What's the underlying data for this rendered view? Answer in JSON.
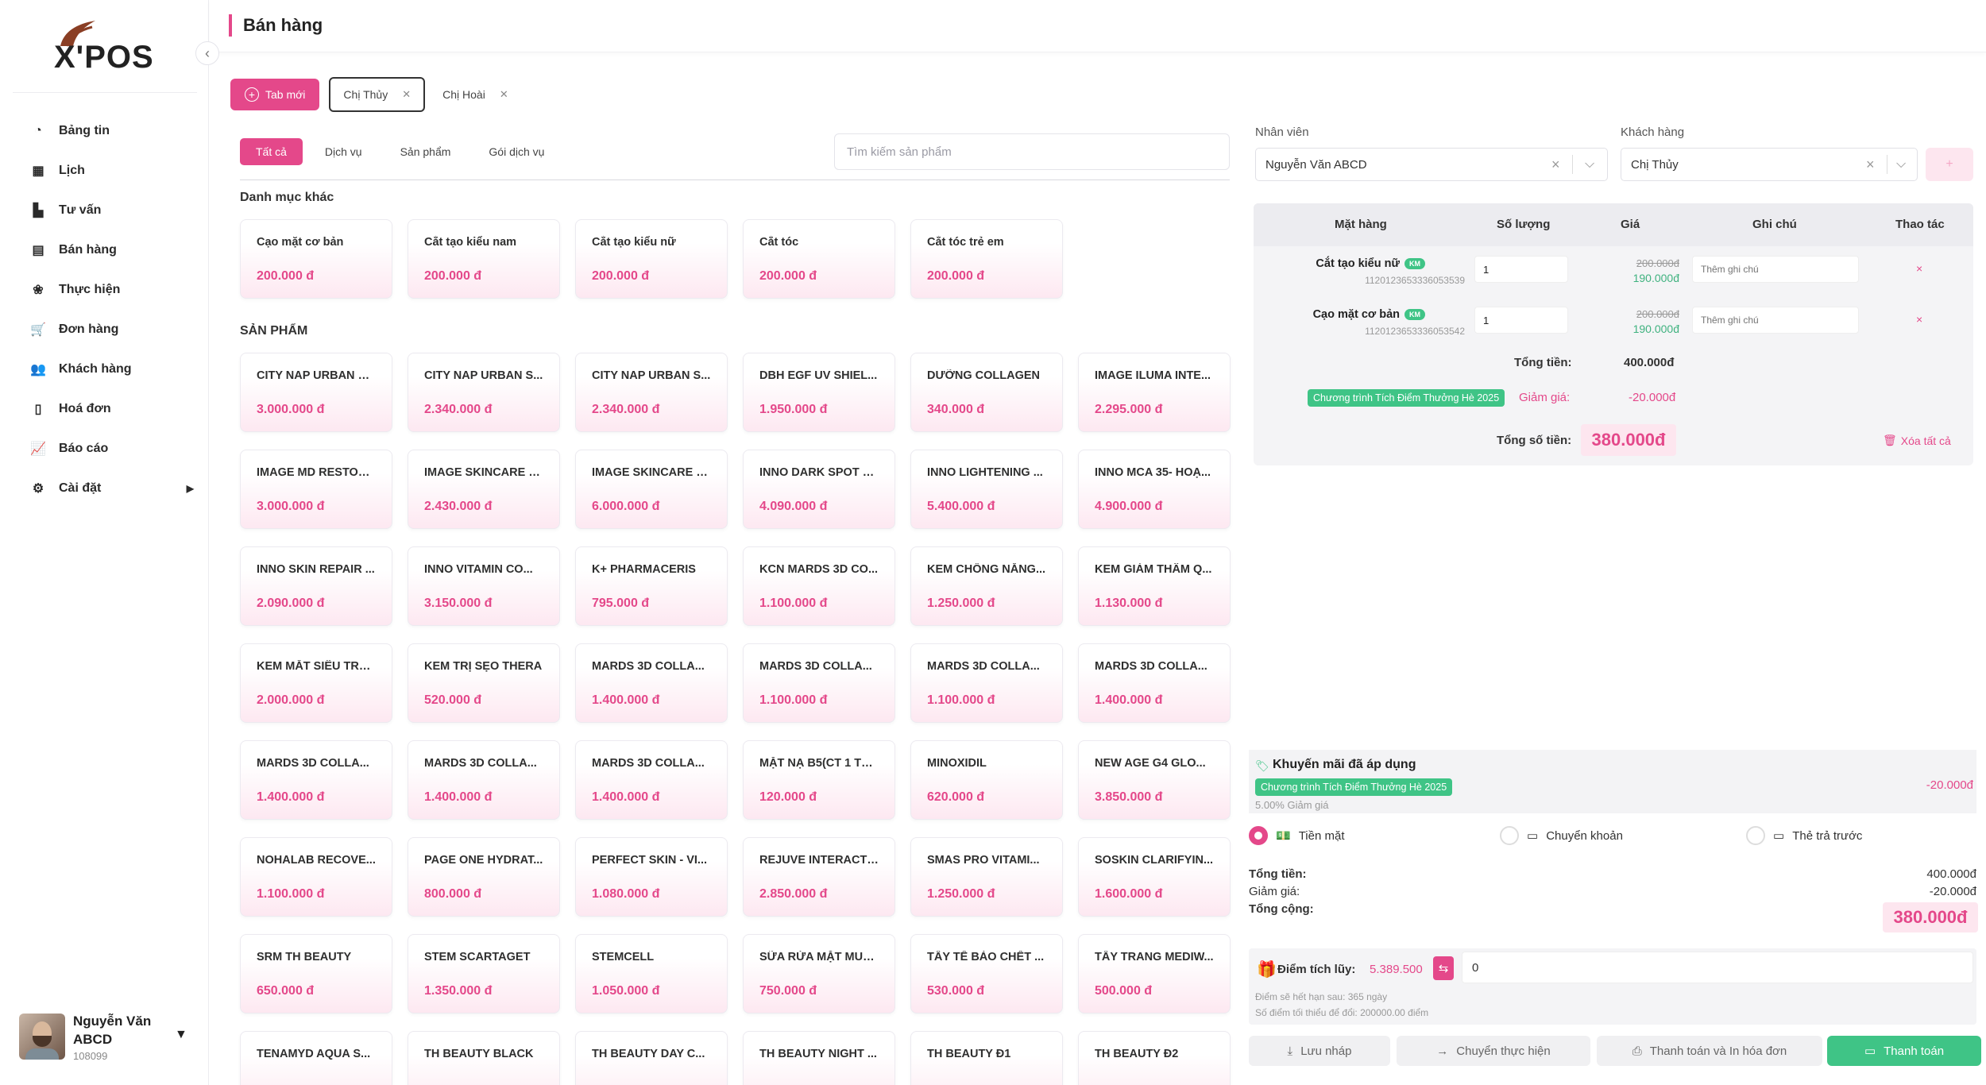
{
  "app": {
    "logo_text": "X'POS"
  },
  "header": {
    "title": "Bán hàng"
  },
  "sidebar": {
    "items": [
      {
        "label": "Bảng tin",
        "icon": "dashboard-icon"
      },
      {
        "label": "Lịch",
        "icon": "calendar-icon"
      },
      {
        "label": "Tư vấn",
        "icon": "consult-icon"
      },
      {
        "label": "Bán hàng",
        "icon": "store-icon"
      },
      {
        "label": "Thực hiện",
        "icon": "lotus-icon"
      },
      {
        "label": "Đơn hàng",
        "icon": "cart-icon"
      },
      {
        "label": "Khách hàng",
        "icon": "users-icon"
      },
      {
        "label": "Hoá đơn",
        "icon": "invoice-icon"
      },
      {
        "label": "Báo cáo",
        "icon": "chart-icon"
      },
      {
        "label": "Cài đặt",
        "icon": "gear-icon",
        "arrow": "▶"
      }
    ],
    "user": {
      "name": "Nguyễn Văn ABCD",
      "code": "108099"
    }
  },
  "tabs": {
    "new_tab": "Tab mới",
    "customer_tabs": [
      {
        "label": "Chị Thủy",
        "active": true
      },
      {
        "label": "Chị Hoài",
        "active": false
      }
    ]
  },
  "filters": [
    "Tất cả",
    "Dịch vụ",
    "Sản phẩm",
    "Gói dịch vụ"
  ],
  "search": {
    "placeholder": "Tìm kiếm sản phẩm"
  },
  "sections": {
    "other": "Danh mục khác",
    "products": "SẢN PHẨM"
  },
  "services": [
    {
      "name": "Cạo mặt cơ bản",
      "price": "200.000 đ"
    },
    {
      "name": "Cắt tạo kiểu nam",
      "price": "200.000 đ"
    },
    {
      "name": "Cắt tạo kiểu nữ",
      "price": "200.000 đ"
    },
    {
      "name": "Cắt tóc",
      "price": "200.000 đ"
    },
    {
      "name": "Cắt tóc trẻ em",
      "price": "200.000 đ"
    }
  ],
  "products": [
    {
      "name": "CITY NAP URBAN N...",
      "price": "3.000.000 đ"
    },
    {
      "name": "CITY NAP URBAN S...",
      "price": "2.340.000 đ"
    },
    {
      "name": "CITY NAP URBAN S...",
      "price": "2.340.000 đ"
    },
    {
      "name": "DBH EGF UV SHIEL...",
      "price": "1.950.000 đ"
    },
    {
      "name": "DƯỠNG COLLAGEN",
      "price": "340.000 đ"
    },
    {
      "name": "IMAGE ILUMA INTE...",
      "price": "2.295.000 đ"
    },
    {
      "name": "IMAGE MD RESTOR...",
      "price": "3.000.000 đ"
    },
    {
      "name": "IMAGE SKINCARE P...",
      "price": "2.430.000 đ"
    },
    {
      "name": "IMAGE SKINCARE P...",
      "price": "6.000.000 đ"
    },
    {
      "name": "INNO DARK SPOT E...",
      "price": "4.090.000 đ"
    },
    {
      "name": "INNO LIGHTENING ...",
      "price": "5.400.000 đ"
    },
    {
      "name": "INNO MCA 35- HOẠ...",
      "price": "4.900.000 đ"
    },
    {
      "name": "INNO SKIN REPAIR ...",
      "price": "2.090.000 đ"
    },
    {
      "name": "INNO VITAMIN CO...",
      "price": "3.150.000 đ"
    },
    {
      "name": "K+ PHARMACERIS",
      "price": "795.000 đ"
    },
    {
      "name": "KCN MARDS 3D CO...",
      "price": "1.100.000 đ"
    },
    {
      "name": "KEM CHỐNG NẮNG...",
      "price": "1.250.000 đ"
    },
    {
      "name": "KEM GIẢM THÂM Q...",
      "price": "1.130.000 đ"
    },
    {
      "name": "KEM MẮT SIÊU TRẺ...",
      "price": "2.000.000 đ"
    },
    {
      "name": "KEM TRỊ SẸO THERA",
      "price": "520.000 đ"
    },
    {
      "name": "MARDS 3D COLLA...",
      "price": "1.400.000 đ"
    },
    {
      "name": "MARDS 3D COLLA...",
      "price": "1.100.000 đ"
    },
    {
      "name": "MARDS 3D COLLA...",
      "price": "1.100.000 đ"
    },
    {
      "name": "MARDS 3D COLLA...",
      "price": "1.400.000 đ"
    },
    {
      "name": "MARDS 3D COLLA...",
      "price": "1.400.000 đ"
    },
    {
      "name": "MARDS 3D COLLA...",
      "price": "1.400.000 đ"
    },
    {
      "name": "MARDS 3D COLLA...",
      "price": "1.400.000 đ"
    },
    {
      "name": "MẶT NẠ B5(CT 1 TẶ...",
      "price": "120.000 đ"
    },
    {
      "name": "MINOXIDIL",
      "price": "620.000 đ"
    },
    {
      "name": "NEW AGE G4 GLO...",
      "price": "3.850.000 đ"
    },
    {
      "name": "NOHALAB RECOVE...",
      "price": "1.100.000 đ"
    },
    {
      "name": "PAGE ONE HYDRAT...",
      "price": "800.000 đ"
    },
    {
      "name": "PERFECT SKIN - VI...",
      "price": "1.080.000 đ"
    },
    {
      "name": "REJUVE INTERACTI...",
      "price": "2.850.000 đ"
    },
    {
      "name": "SMAS PRO VITAMI...",
      "price": "1.250.000 đ"
    },
    {
      "name": "SOSKIN CLARIFYIN...",
      "price": "1.600.000 đ"
    },
    {
      "name": "SRM TH BEAUTY",
      "price": "650.000 đ"
    },
    {
      "name": "STEM SCARTAGET",
      "price": "1.350.000 đ"
    },
    {
      "name": "STEMCELL",
      "price": "1.050.000 đ"
    },
    {
      "name": "SỮA RỬA MẶT MUL...",
      "price": "750.000 đ"
    },
    {
      "name": "TẨY TẾ BÀO CHẾT ...",
      "price": "530.000 đ"
    },
    {
      "name": "TẨY TRANG MEDIW...",
      "price": "500.000 đ"
    },
    {
      "name": "TENAMYD AQUA S...",
      "price": ""
    },
    {
      "name": "TH BEAUTY BLACK",
      "price": ""
    },
    {
      "name": "TH BEAUTY DAY C...",
      "price": ""
    },
    {
      "name": "TH BEAUTY NIGHT ...",
      "price": ""
    },
    {
      "name": "TH BEAUTY Đ1",
      "price": ""
    },
    {
      "name": "TH BEAUTY Đ2",
      "price": ""
    }
  ],
  "staff": {
    "label": "Nhân viên",
    "value": "Nguyễn Văn ABCD"
  },
  "customer": {
    "label": "Khách hàng",
    "value": "Chị Thủy",
    "add": "+"
  },
  "cart": {
    "headers": [
      "Mặt hàng",
      "Số lượng",
      "Giá",
      "Ghi chú",
      "Thao tác"
    ],
    "rows": [
      {
        "name": "Cắt tạo kiểu nữ",
        "badge": "KM",
        "code": "1120123653336053539",
        "qty": "1",
        "old_price": "200.000đ",
        "new_price": "190.000đ",
        "note_placeholder": "Thêm ghi chú",
        "del": "×"
      },
      {
        "name": "Cạo mặt cơ bản",
        "badge": "KM",
        "code": "1120123653336053542",
        "qty": "1",
        "old_price": "200.000đ",
        "new_price": "190.000đ",
        "note_placeholder": "Thêm ghi chú",
        "del": "×"
      }
    ],
    "total_label": "Tổng tiền:",
    "total_value": "400.000đ",
    "promo_pill": "Chương trình Tích Điểm Thưởng Hè 2025",
    "discount_label": "Giảm giá:",
    "discount_value": "-20.000đ",
    "grand_label": "Tổng số tiền:",
    "grand_value": "380.000đ",
    "clear_all": "Xóa tất cả"
  },
  "promotions": {
    "title": "Khuyến mãi đã áp dụng",
    "pill": "Chương trình Tích Điểm Thưởng Hè 2025",
    "value": "-20.000đ",
    "sub": "5.00% Giảm giá"
  },
  "payment": {
    "options": [
      "Tiền mặt",
      "Chuyển khoản",
      "Thẻ trả trước"
    ],
    "selected": 0
  },
  "summary": {
    "total_label": "Tổng tiền:",
    "total_value": "400.000đ",
    "discount_label": "Giảm giá:",
    "discount_value": "-20.000đ",
    "grand_label": "Tổng cộng:",
    "grand_value": "380.000đ"
  },
  "points": {
    "label": "Điểm tích lũy:",
    "value": "5.389.500",
    "input": "0",
    "note1": "Điểm sẽ hết hạn sau: 365 ngày",
    "note2": "Số điểm tối thiểu để đổi: 200000.00 điểm"
  },
  "actions": {
    "save_draft": "Lưu nháp",
    "transfer": "Chuyển thực hiện",
    "pay_print": "Thanh toán và In hóa đơn",
    "pay": "Thanh toán"
  },
  "colors": {
    "accent": "#e4488a",
    "green": "#3fc486"
  }
}
